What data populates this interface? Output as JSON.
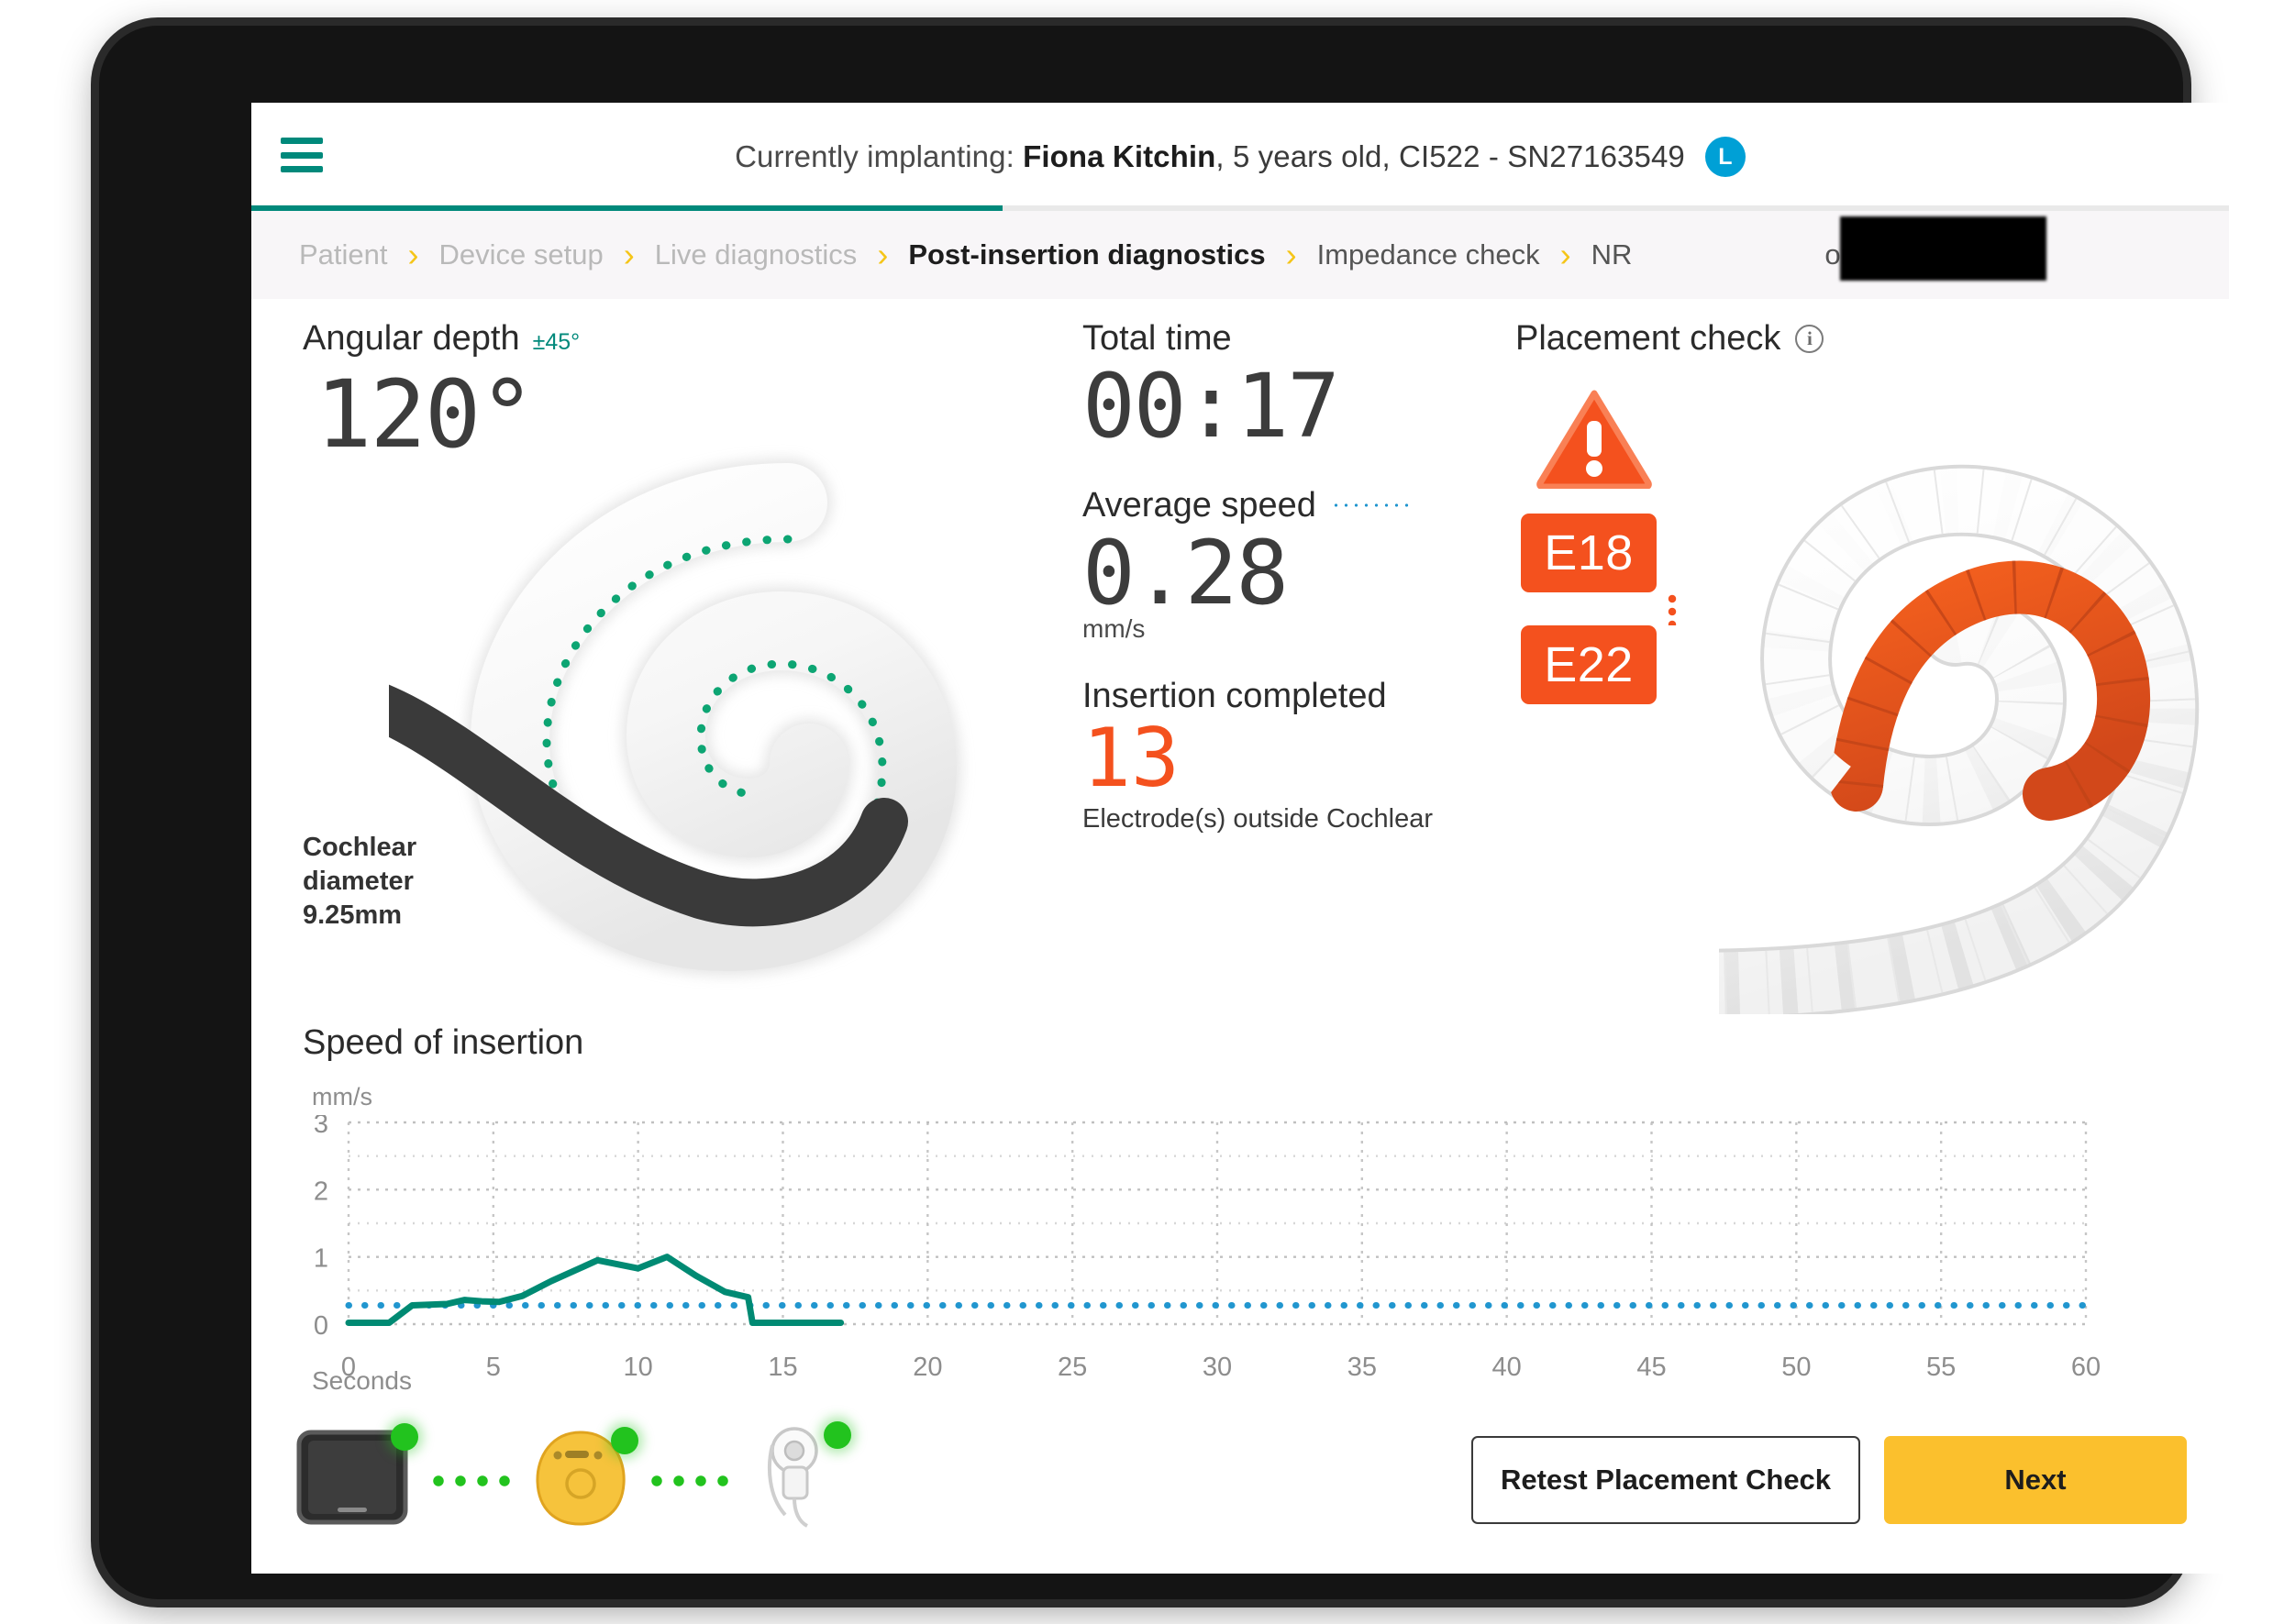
{
  "header": {
    "menu_icon": "hamburger-icon",
    "banner_prefix": "Currently implanting:",
    "patient_name": "Fiona Kitchin",
    "patient_details": ", 5 years old, CI522 - SN27163549",
    "ear_badge": "L",
    "progress_percent": 38
  },
  "breadcrumb": {
    "items": [
      {
        "label": "Patient",
        "state": "done"
      },
      {
        "label": "Device setup",
        "state": "done"
      },
      {
        "label": "Live diagnostics",
        "state": "done"
      },
      {
        "label": "Post-insertion diagnostics",
        "state": "active"
      },
      {
        "label": "Impedance check",
        "state": "upcoming"
      },
      {
        "label": "NR",
        "state": "upcoming"
      },
      {
        "label": "on",
        "state": "upcoming"
      }
    ],
    "separator": "›"
  },
  "angular_depth": {
    "title": "Angular depth",
    "tolerance": "±45°",
    "value": "120°",
    "cochlear_diameter": "Cochlear\ndiameter\n9.25mm"
  },
  "metrics": {
    "total_time_label": "Total time",
    "total_time_value": "00:17",
    "average_speed_label": "Average speed",
    "average_speed_value": "0.28",
    "average_speed_unit": "mm/s",
    "insertion_completed_label": "Insertion completed",
    "electrodes_outside_value": "13",
    "electrodes_outside_caption": "Electrode(s) outside Cochlear"
  },
  "placement_check": {
    "title": "Placement check",
    "info_icon": "info-icon",
    "warning_icon": "warning-triangle-icon",
    "badge_from": "E18",
    "badge_to": "E22",
    "accent_color": "#f4511e"
  },
  "chart_data": {
    "type": "line",
    "title": "Speed of insertion",
    "xlabel": "Seconds",
    "ylabel": "mm/s",
    "xlim": [
      0,
      60
    ],
    "ylim": [
      0,
      3
    ],
    "xticks": [
      0,
      5,
      10,
      15,
      20,
      25,
      30,
      35,
      40,
      45,
      50,
      55,
      60
    ],
    "yticks": [
      0,
      1,
      2,
      3
    ],
    "minor_y_gridlines": [
      0.5,
      1.5,
      2.5
    ],
    "grid": true,
    "legend_position": "inline-metric",
    "series": [
      {
        "name": "Speed of insertion",
        "color": "#008a73",
        "style": "solid",
        "x": [
          0,
          1.4,
          2.2,
          3.4,
          4.0,
          4.6,
          5.2,
          6.0,
          7.0,
          8.6,
          10.0,
          11.0,
          12.0,
          13.0,
          13.8,
          13.95,
          17.0
        ],
        "y": [
          0.02,
          0.02,
          0.28,
          0.3,
          0.36,
          0.34,
          0.33,
          0.42,
          0.64,
          0.95,
          0.83,
          1.0,
          0.72,
          0.48,
          0.4,
          0.02,
          0.02
        ]
      },
      {
        "name": "Average speed",
        "color": "#2196cf",
        "style": "dotted",
        "value": 0.28
      }
    ]
  },
  "footer": {
    "devices": [
      {
        "name": "tablet-device",
        "status": "connected"
      },
      {
        "name": "sound-processor-device",
        "status": "connected"
      },
      {
        "name": "coil-device",
        "status": "connected"
      }
    ],
    "connection_status_color": "#22c31e",
    "retest_button": "Retest Placement Check",
    "next_button": "Next"
  }
}
